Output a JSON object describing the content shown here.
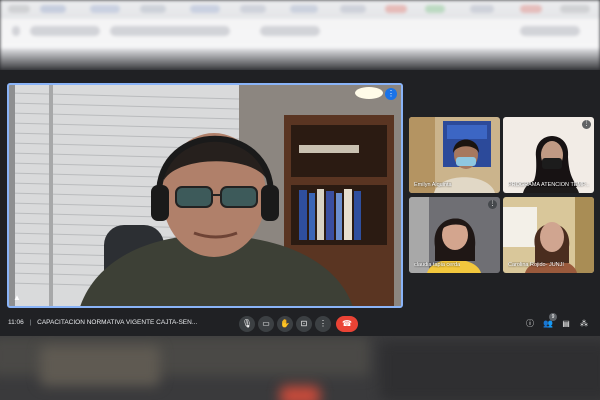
{
  "meeting": {
    "time": "11:06",
    "title": "CAPACITACION NORMATIVA VIGENTE CAJTA-SEN..."
  },
  "participants": [
    {
      "name": "Emilyn Alquinta"
    },
    {
      "name": "PROGRAMA ATENCION TEMP..."
    },
    {
      "name": "claudia tapia cerda"
    },
    {
      "name": "Carolina Rojido- JUNJI"
    }
  ],
  "controls": {
    "mic_icon": "microphone-icon",
    "camera_icon": "camera-icon",
    "hand_icon": "raise-hand-icon",
    "present_icon": "present-screen-icon",
    "more_icon": "more-options-icon",
    "hangup_icon": "hang-up-icon",
    "people_count": "9"
  },
  "colors": {
    "accent": "#8ab4f8",
    "hangup": "#ea4335",
    "background": "#202124"
  }
}
